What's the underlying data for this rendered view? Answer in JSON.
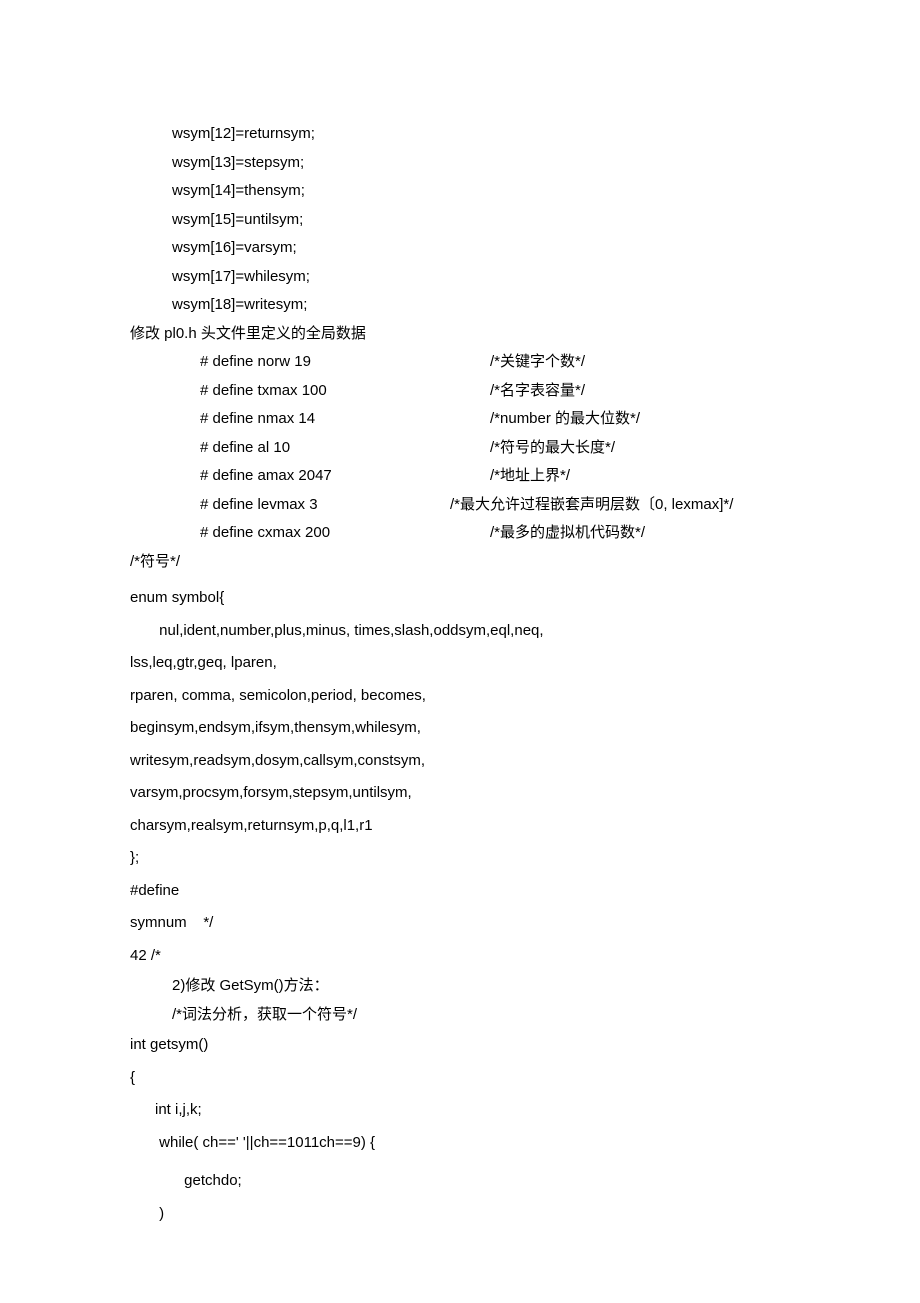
{
  "wsym": [
    "wsym[12]=returnsym;",
    "wsym[13]=stepsym;",
    "wsym[14]=thensym;",
    "wsym[15]=untilsym;",
    "wsym[16]=varsym;",
    "wsym[17]=whilesym;",
    "wsym[18]=writesym;"
  ],
  "modify_header": "修改 pl0.h 头文件里定义的全局数据",
  "defines": [
    {
      "code": "# define norw 19",
      "comment": "/*关键字个数*/"
    },
    {
      "code": "# define txmax 100",
      "comment": "/*名字表容量*/"
    },
    {
      "code": "# define nmax 14",
      "comment": "  /*number 的最大位数*/"
    },
    {
      "code": "# define al 10",
      "comment": "/*符号的最大长度*/"
    },
    {
      "code": "# define amax 2047",
      "comment": "/*地址上界*/"
    },
    {
      "code": "# define levmax 3",
      "comment": "/*最大允许过程嵌套声明层数〔0,      lexmax]*/"
    },
    {
      "code": "# define cxmax 200",
      "comment": "    /*最多的虚拟机代码数*/"
    }
  ],
  "symbol_comment": "/*符号*/",
  "enum_block": [
    "enum symbol{",
    "       nul,ident,number,plus,minus, times,slash,oddsym,eql,neq,",
    "lss,leq,gtr,geq, lparen,",
    "rparen, comma, semicolon,period, becomes,",
    "beginsym,endsym,ifsym,thensym,whilesym,",
    "writesym,readsym,dosym,callsym,constsym,",
    "varsym,procsym,forsym,stepsym,untilsym,",
    "charsym,realsym,returnsym,p,q,l1,r1",
    "};",
    "#define",
    "symnum    */",
    "42 /*"
  ],
  "section2_title": "2)修改 GetSym()方法：",
  "section2_comment": "/*词法分析，获取一个符号*/",
  "getsym": [
    "int getsym()",
    "{",
    "      int i,j,k;",
    "       while( ch==' '||ch==1011ch==9) {",
    "             getchdo;",
    "       )"
  ]
}
